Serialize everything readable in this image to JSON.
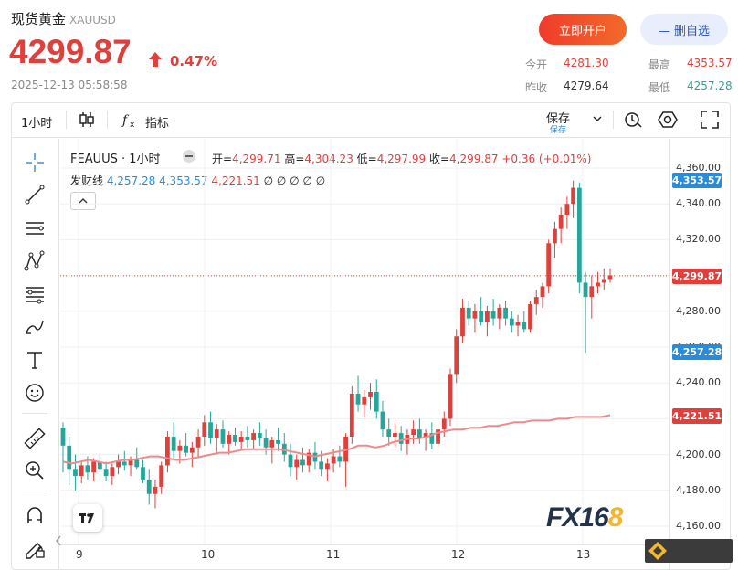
{
  "header": {
    "name": "现货黄金",
    "symbol": "XAUUSD",
    "price": "4299.87",
    "change_pct": "0.47%",
    "timestamp": "2025-12-13 05:58:58",
    "buttons": {
      "open_account": "立即开户",
      "remove_favorite": "— 删自选"
    },
    "quote": {
      "open_label": "今开",
      "open": "4281.30",
      "high_label": "最高",
      "high": "4353.57",
      "prev_close_label": "昨收",
      "prev_close": "4279.64",
      "low_label": "最低",
      "low": "4257.28"
    },
    "colors": {
      "up": "#e0403b",
      "down": "#26a69a",
      "accent": "#2d58c6"
    }
  },
  "toolbar": {
    "interval": "1小时",
    "indicators": "指标",
    "save": "保存",
    "save_sub": "保存",
    "icons": [
      "candle-type-icon",
      "fx-indicator-icon",
      "chevron-down-icon",
      "alert-clock-icon",
      "settings-hexagon-icon",
      "fullscreen-icon"
    ]
  },
  "left_tools": [
    "crosshair-icon",
    "trendline-icon",
    "horizontal-lines-icon",
    "pattern-icon",
    "fib-icon",
    "brush-icon",
    "text-icon",
    "emoji-icon",
    "ruler-icon",
    "zoom-in-icon",
    "magnet-icon",
    "lock-pen-icon"
  ],
  "legend": {
    "symbol": "FEAUUS",
    "interval": "1小时",
    "open_label": "开=",
    "open": "4,299.71",
    "high_label": "高=",
    "high": "4,304.23",
    "low_label": "低=",
    "low": "4,297.99",
    "close_label": "收=",
    "close": "4,299.87",
    "change": "+0.36 (+0.01%)",
    "indicator": "发财线",
    "ind_v1": "4,257.28",
    "ind_v2": "4,353.57",
    "ind_v3": "4,221.51",
    "ind_rest": "∅ ∅ ∅ ∅ ∅"
  },
  "chart_data": {
    "type": "candlestick",
    "y_ticks": [
      "4,360.00",
      "4,340.00",
      "4,320.00",
      "4,280.00",
      "4,260.00",
      "4,240.00",
      "4,200.00",
      "4,180.00",
      "4,160.00"
    ],
    "x_ticks": [
      "9",
      "10",
      "11",
      "12",
      "13"
    ],
    "price_badges": [
      {
        "value": "4,353.57",
        "color": "#2a8bd8"
      },
      {
        "value": "4,299.87",
        "color": "#e0403b"
      },
      {
        "value": "4,257.28",
        "color": "#2a8bd8"
      },
      {
        "value": "4,221.51",
        "color": "#e0403b"
      }
    ],
    "ylim": [
      4150,
      4370
    ],
    "ohlc": [
      [
        4215,
        4218,
        4190,
        4205
      ],
      [
        4205,
        4210,
        4183,
        4192
      ],
      [
        4192,
        4200,
        4180,
        4188
      ],
      [
        4188,
        4196,
        4184,
        4194
      ],
      [
        4194,
        4199,
        4186,
        4190
      ],
      [
        4190,
        4198,
        4185,
        4196
      ],
      [
        4196,
        4200,
        4190,
        4192
      ],
      [
        4192,
        4196,
        4185,
        4188
      ],
      [
        4188,
        4195,
        4183,
        4193
      ],
      [
        4193,
        4200,
        4189,
        4196
      ],
      [
        4196,
        4202,
        4191,
        4194
      ],
      [
        4194,
        4199,
        4188,
        4197
      ],
      [
        4197,
        4204,
        4192,
        4193
      ],
      [
        4193,
        4197,
        4184,
        4186
      ],
      [
        4186,
        4192,
        4172,
        4178
      ],
      [
        4178,
        4186,
        4170,
        4182
      ],
      [
        4182,
        4196,
        4178,
        4194
      ],
      [
        4194,
        4213,
        4190,
        4210
      ],
      [
        4210,
        4218,
        4198,
        4202
      ],
      [
        4202,
        4208,
        4195,
        4205
      ],
      [
        4205,
        4212,
        4199,
        4201
      ],
      [
        4201,
        4207,
        4193,
        4204
      ],
      [
        4204,
        4214,
        4198,
        4210
      ],
      [
        4210,
        4222,
        4205,
        4218
      ],
      [
        4218,
        4224,
        4206,
        4209
      ],
      [
        4209,
        4217,
        4200,
        4214
      ],
      [
        4214,
        4219,
        4204,
        4206
      ],
      [
        4206,
        4213,
        4200,
        4211
      ],
      [
        4211,
        4215,
        4205,
        4207
      ],
      [
        4207,
        4213,
        4203,
        4210
      ],
      [
        4210,
        4216,
        4204,
        4208
      ],
      [
        4208,
        4214,
        4203,
        4212
      ],
      [
        4212,
        4218,
        4205,
        4209
      ],
      [
        4209,
        4214,
        4200,
        4204
      ],
      [
        4204,
        4210,
        4195,
        4208
      ],
      [
        4208,
        4215,
        4202,
        4206
      ],
      [
        4206,
        4212,
        4196,
        4200
      ],
      [
        4200,
        4206,
        4188,
        4193
      ],
      [
        4193,
        4200,
        4186,
        4197
      ],
      [
        4197,
        4204,
        4190,
        4194
      ],
      [
        4194,
        4203,
        4190,
        4201
      ],
      [
        4201,
        4207,
        4192,
        4196
      ],
      [
        4196,
        4202,
        4188,
        4192
      ],
      [
        4192,
        4198,
        4185,
        4195
      ],
      [
        4195,
        4203,
        4190,
        4199
      ],
      [
        4199,
        4205,
        4193,
        4196
      ],
      [
        4196,
        4212,
        4182,
        4210
      ],
      [
        4210,
        4238,
        4206,
        4234
      ],
      [
        4234,
        4244,
        4224,
        4228
      ],
      [
        4228,
        4236,
        4221,
        4232
      ],
      [
        4232,
        4240,
        4225,
        4235
      ],
      [
        4235,
        4242,
        4220,
        4224
      ],
      [
        4224,
        4230,
        4210,
        4214
      ],
      [
        4214,
        4220,
        4205,
        4210
      ],
      [
        4210,
        4218,
        4204,
        4212
      ],
      [
        4212,
        4216,
        4202,
        4206
      ],
      [
        4206,
        4214,
        4200,
        4211
      ],
      [
        4211,
        4219,
        4206,
        4214
      ],
      [
        4214,
        4220,
        4206,
        4209
      ],
      [
        4209,
        4214,
        4202,
        4212
      ],
      [
        4212,
        4218,
        4203,
        4206
      ],
      [
        4206,
        4216,
        4202,
        4214
      ],
      [
        4214,
        4224,
        4210,
        4220
      ],
      [
        4220,
        4248,
        4216,
        4245
      ],
      [
        4245,
        4270,
        4240,
        4266
      ],
      [
        4266,
        4287,
        4262,
        4282
      ],
      [
        4282,
        4286,
        4272,
        4276
      ],
      [
        4276,
        4284,
        4268,
        4280
      ],
      [
        4280,
        4288,
        4272,
        4274
      ],
      [
        4274,
        4283,
        4266,
        4280
      ],
      [
        4280,
        4287,
        4272,
        4276
      ],
      [
        4276,
        4284,
        4270,
        4282
      ],
      [
        4282,
        4286,
        4272,
        4276
      ],
      [
        4276,
        4280,
        4268,
        4272
      ],
      [
        4272,
        4278,
        4266,
        4274
      ],
      [
        4274,
        4280,
        4268,
        4270
      ],
      [
        4270,
        4286,
        4268,
        4284
      ],
      [
        4284,
        4292,
        4278,
        4288
      ],
      [
        4288,
        4296,
        4282,
        4294
      ],
      [
        4294,
        4320,
        4290,
        4318
      ],
      [
        4318,
        4330,
        4310,
        4326
      ],
      [
        4326,
        4338,
        4318,
        4334
      ],
      [
        4334,
        4344,
        4326,
        4340
      ],
      [
        4340,
        4353,
        4332,
        4349
      ],
      [
        4349,
        4352,
        4290,
        4296
      ],
      [
        4296,
        4302,
        4257,
        4288
      ],
      [
        4288,
        4300,
        4276,
        4294
      ],
      [
        4294,
        4302,
        4290,
        4296
      ],
      [
        4296,
        4304,
        4292,
        4298
      ],
      [
        4298,
        4304,
        4296,
        4300
      ]
    ],
    "ma": [
      4196,
      4195,
      4196,
      4197,
      4196,
      4195,
      4196,
      4197,
      4197,
      4198,
      4199,
      4199,
      4198,
      4197,
      4197,
      4198,
      4199,
      4200,
      4201,
      4201,
      4202,
      4203,
      4203,
      4203,
      4203,
      4203,
      4202,
      4201,
      4200,
      4199,
      4200,
      4201,
      4202,
      4203,
      4205,
      4205,
      4204,
      4205,
      4207,
      4208,
      4209,
      4209,
      4210,
      4212,
      4213,
      4214,
      4214,
      4215,
      4215,
      4216,
      4216,
      4217,
      4218,
      4218,
      4219,
      4219,
      4219,
      4220,
      4220,
      4221,
      4221,
      4221,
      4221,
      4222
    ]
  }
}
